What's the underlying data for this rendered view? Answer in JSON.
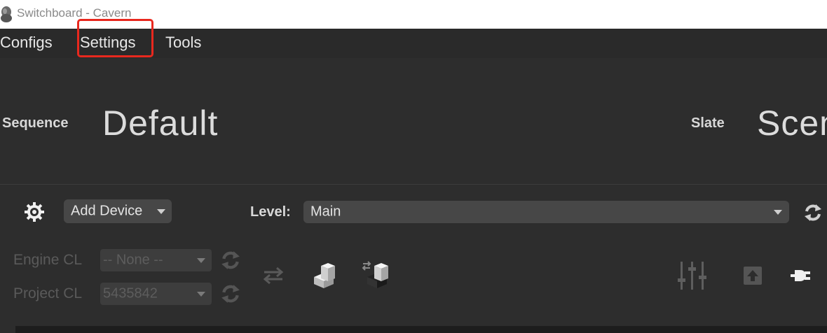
{
  "window": {
    "title": "Switchboard - Cavern"
  },
  "menu": {
    "items": [
      "Configs",
      "Settings",
      "Tools"
    ]
  },
  "header": {
    "sequence_label": "Sequence",
    "sequence_value": "Default",
    "slate_label": "Slate",
    "slate_value": "Scen"
  },
  "toolbar": {
    "add_device_label": "Add Device",
    "level_label": "Level:",
    "level_value": "Main"
  },
  "changelist": {
    "engine_label": "Engine CL",
    "engine_value": "-- None --",
    "project_label": "Project CL",
    "project_value": "5435842"
  },
  "icons": {
    "app": "app-icon",
    "settings": "gear-icon",
    "refresh": "refresh-icon",
    "swap": "swap-icon",
    "build": "build-icon",
    "sync_build": "sync-build-icon",
    "mixer": "sliders-icon",
    "upload": "upload-icon",
    "connect": "plug-icon"
  },
  "colors": {
    "highlight": "#e8281e",
    "background": "#2d2d2d",
    "dropdown": "#474747"
  }
}
